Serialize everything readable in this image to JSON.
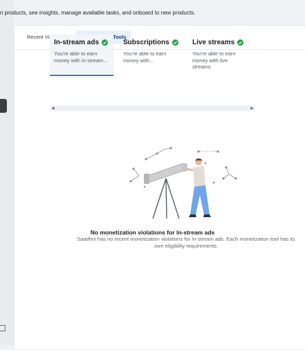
{
  "header": {
    "intro_text": "n products, see insights, manage available tasks, and onboard to new products."
  },
  "tabs": [
    {
      "label": "Recent Violations",
      "active": false
    },
    {
      "label": "Monetization Tools",
      "active": true
    }
  ],
  "tools": [
    {
      "title": "In-stream ads",
      "desc_line1": "You're able to earn",
      "desc_line2": "money with in-stream...",
      "status": "eligible"
    },
    {
      "title": "Subscriptions",
      "desc_line1": "You're able to earn",
      "desc_line2": "money with...",
      "status": "eligible"
    },
    {
      "title": "Live streams",
      "desc_line1": "You're able to earn",
      "desc_line2": "money with live streams",
      "status": "eligible"
    }
  ],
  "empty_state": {
    "title": "No monetization violations for In-stream ads",
    "description": "Saadhni has no recent monetization violations for In-stream ads. Each monetization tool has its own eligibility requirements."
  },
  "icons": {
    "eligible": "green-check-icon",
    "scroll_left": "chevron-left-icon",
    "scroll_right": "chevron-right-icon"
  },
  "colors": {
    "accent": "#3a7bd5",
    "eligible": "#23a04a",
    "active_tab_bg": "#e7f0fa"
  }
}
